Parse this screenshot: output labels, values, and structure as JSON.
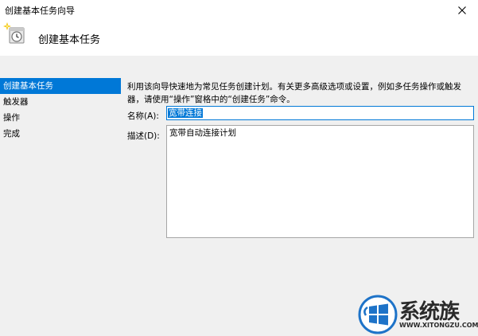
{
  "window": {
    "title": "创建基本任务向导",
    "close_glyph": "✕"
  },
  "header": {
    "title": "创建基本任务",
    "icon": "task-clock-icon"
  },
  "sidebar": {
    "items": [
      {
        "label": "创建基本任务",
        "active": true
      },
      {
        "label": "触发器",
        "active": false
      },
      {
        "label": "操作",
        "active": false
      },
      {
        "label": "完成",
        "active": false
      }
    ]
  },
  "main": {
    "intro": "利用该向导快速地为常见任务创建计划。有关更多高级选项或设置，例如多任务操作或触发器，请使用“操作”窗格中的“创建任务”命令。",
    "name_label": "名称(A):",
    "name_value": "宽带连接",
    "description_label": "描述(D):",
    "description_value": "宽带自动连接计划"
  },
  "watermark": {
    "text": "系统族",
    "url": "WWW.XITONGZU.COM"
  },
  "colors": {
    "accent": "#0078d7",
    "panel_bg": "#f0f0f0"
  }
}
